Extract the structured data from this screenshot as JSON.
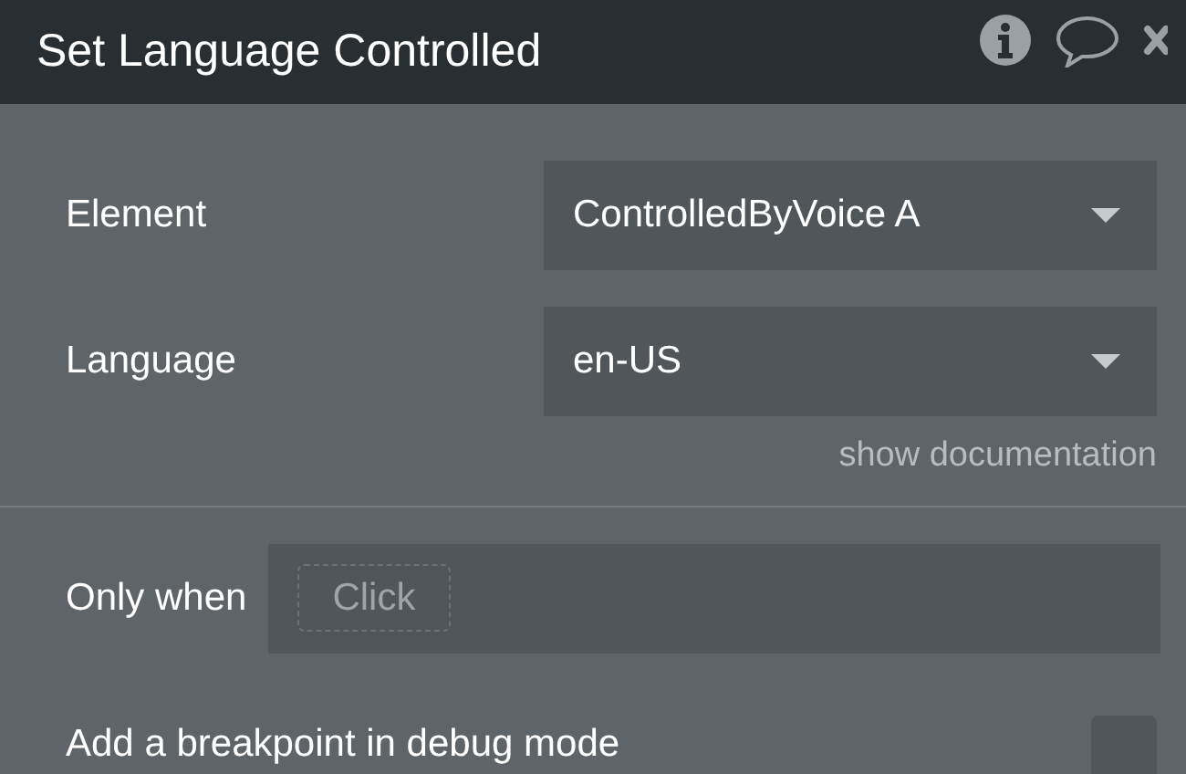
{
  "header": {
    "title": "Set Language Controlled"
  },
  "fields": [
    {
      "label": "Element",
      "value": "ControlledByVoice A"
    },
    {
      "label": "Language",
      "value": "en-US"
    }
  ],
  "documentation_link": "show documentation",
  "condition": {
    "label": "Only when",
    "placeholder": "Click"
  },
  "breakpoint": {
    "label": "Add a breakpoint in debug mode",
    "checked": false
  }
}
